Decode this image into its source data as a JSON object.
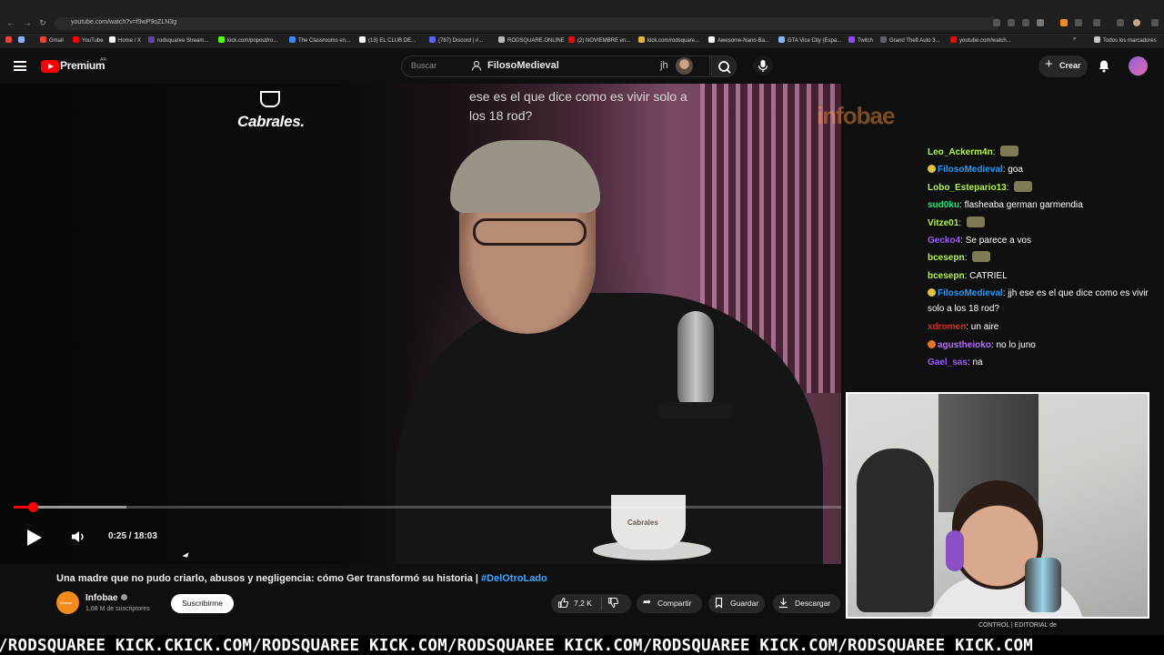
{
  "browser": {
    "url": "youtube.com/watch?v=f9wP9oZLN3g",
    "bookmarks": [
      {
        "label": "Gmail",
        "color": "#ea4335"
      },
      {
        "label": "YouTube",
        "color": "#ff0000"
      },
      {
        "label": "Home / X",
        "color": "#ffffff"
      },
      {
        "label": "rodsquaree Stream...",
        "color": "#6441a5"
      },
      {
        "label": "kick.com/popout/ro...",
        "color": "#53fc18"
      },
      {
        "label": "The Classrooms en...",
        "color": "#4285f4"
      },
      {
        "label": "(13) EL CLUB DE...",
        "color": "#ffffff"
      },
      {
        "label": "(787) Discord | #...",
        "color": "#5865f2"
      },
      {
        "label": "RODSQUARE.ONLINE",
        "color": "#bbbbbb"
      },
      {
        "label": "(2) NOVIEMBRE en...",
        "color": "#ff0000"
      },
      {
        "label": "kick.com/rodsquare...",
        "color": "#e3b341"
      },
      {
        "label": "Awesome-Nano-Ba...",
        "color": "#ffffff"
      },
      {
        "label": "GTA Vice City (Espa...",
        "color": "#8ab4f8"
      },
      {
        "label": "Twitch",
        "color": "#9146ff"
      },
      {
        "label": "Grand Theft Auto 3...",
        "color": "#5f6368"
      },
      {
        "label": "youtube.com/watch...",
        "color": "#ff0000"
      }
    ],
    "all_bookmarks_label": "Todos los marcadores"
  },
  "header": {
    "brand": "Premium",
    "country": "AR",
    "search_placeholder": "Buscar",
    "profile_name": "FilosoMedieval",
    "jh_text": "jh",
    "create_label": "Crear"
  },
  "video": {
    "sponsor_logo": "Cabrales.",
    "caption": "ese es el que dice como es vivir solo a los 18 rod?",
    "watermark": "infobae",
    "cup_logo": "Cabrales",
    "time": "0:25 / 18:03",
    "progress_fraction": 0.0231,
    "buffer_fraction": 0.136
  },
  "chat": [
    {
      "user": "Leo_Ackerm4n",
      "color": "#b1f54a",
      "text": "",
      "emote": true,
      "badge": ""
    },
    {
      "user": "FilosoMedieval",
      "color": "#1e9cff",
      "text": "goa",
      "emote": false,
      "badge": "#e1c43b"
    },
    {
      "user": "Lobo_Estepario13",
      "color": "#b1f54a",
      "text": "",
      "emote": true,
      "badge": ""
    },
    {
      "user": "sud0ku",
      "color": "#2fe07a",
      "text": "flasheaba german garmendia",
      "emote": false,
      "badge": ""
    },
    {
      "user": "Vitze01",
      "color": "#b1f54a",
      "text": "",
      "emote": true,
      "badge": ""
    },
    {
      "user": "Gecko4",
      "color": "#9b59ff",
      "text": "Se parece a vos",
      "emote": false,
      "badge": ""
    },
    {
      "user": "bcesepn",
      "color": "#b1f54a",
      "text": "",
      "emote": true,
      "badge": ""
    },
    {
      "user": "bcesepn",
      "color": "#b1f54a",
      "text": "CATRIEL",
      "emote": false,
      "badge": ""
    },
    {
      "user": "FilosoMedieval",
      "color": "#1e9cff",
      "text": "jjh ese es el que dice como es vivir solo a los 18 rod?",
      "emote": false,
      "badge": "#e1c43b"
    },
    {
      "user": "xdromen",
      "color": "#d22f2f",
      "text": "un aire",
      "emote": false,
      "badge": ""
    },
    {
      "user": "agustheioko",
      "color": "#b46bff",
      "text": "no lo juno",
      "emote": false,
      "badge": "#e8732b"
    },
    {
      "user": "Gael_sas",
      "color": "#9b59ff",
      "text": "na",
      "emote": false,
      "badge": ""
    }
  ],
  "below": {
    "title": "Una madre que no pudo criarlo, abusos y negligencia: cómo Ger transformó su historia | ",
    "hashtag": "#DelOtroLado",
    "channel_avatar_label": "infobae",
    "channel_name": "Infobae",
    "subscribers": "1,68 M de suscriptores",
    "subscribe_label": "Suscribirme",
    "likes": "7,2 K",
    "share_label": "Compartir",
    "save_label": "Guardar",
    "download_label": "Descargar"
  },
  "stream": {
    "ticker": "/RODSQUAREE KICK.CKICK.COM/RODSQUAREE KICK.COM/RODSQUAREE KICK.COM/RODSQUAREE KICK.COM/RODSQUAREE KICK.COM",
    "overlay_bottom": "CONTROL | EDITORIAL de"
  }
}
